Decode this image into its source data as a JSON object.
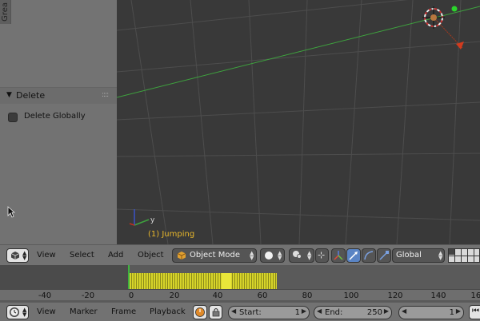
{
  "shelf": {
    "tab_label": "Grea",
    "panel_title": "Delete",
    "option_label": "Delete Globally",
    "option_checked": false
  },
  "viewport": {
    "object_label": "(1) Jumping",
    "axis_y_label": "y"
  },
  "view3d_header": {
    "menus": [
      "View",
      "Select",
      "Add",
      "Object"
    ],
    "mode_label": "Object Mode",
    "orientation_label": "Global"
  },
  "timeline": {
    "ruler_ticks": [
      "-40",
      "-20",
      "0",
      "20",
      "40",
      "60",
      "80",
      "100",
      "120",
      "140",
      "160"
    ],
    "header_menus": [
      "View",
      "Marker",
      "Frame",
      "Playback"
    ],
    "start_label": "Start:",
    "start_value": "1",
    "end_label": "End:",
    "end_value": "250",
    "current_frame": "1"
  },
  "colors": {
    "viewport_bg": "#393939",
    "grid_line": "#4d4d4d",
    "x_axis": "#a33a1e",
    "y_axis": "#3ea23e",
    "object_label": "#e8b72b",
    "keyframes": "#d7d42a"
  }
}
